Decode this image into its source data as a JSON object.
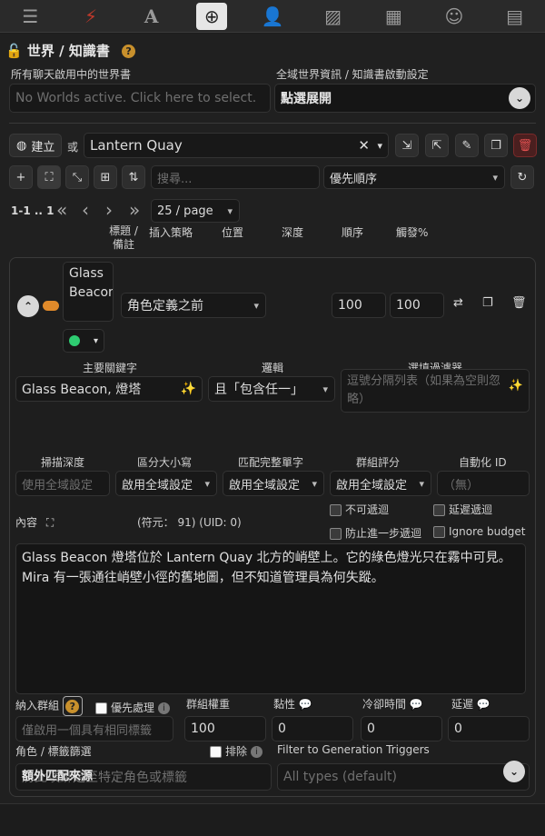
{
  "topbar": {
    "icons": [
      "sliders-icon",
      "plug-icon",
      "font-icon",
      "book-atlas-icon",
      "user-gear-icon",
      "image-icon",
      "cubes-icon",
      "smile-icon",
      "id-card-icon"
    ]
  },
  "header": {
    "title": "世界 / 知識書",
    "help": "?"
  },
  "worlds": {
    "label_active": "所有聊天啟用中的世界書",
    "placeholder": "No Worlds active. Click here to select.",
    "label_settings": "全域世界資訊 / 知識書啟動設定",
    "settings_value": "點選展開"
  },
  "book": {
    "create_label": "建立",
    "or_label": "或",
    "selected": "Lantern Quay"
  },
  "toolbar": {
    "search_placeholder": "搜尋...",
    "sort_value": "優先順序"
  },
  "pager": {
    "range": "1-1 .. 1",
    "per_page": "25 / page"
  },
  "columns": {
    "title": "標題 / 備註",
    "strategy": "插入策略",
    "position": "位置",
    "depth": "深度",
    "order": "順序",
    "trigger": "觸發%"
  },
  "entry": {
    "title": "Glass Beacon",
    "position": "角色定義之前",
    "order": "100",
    "trigger": "100",
    "primary_label": "主要關鍵字",
    "primary_keys": "Glass Beacon, 燈塔",
    "logic_label": "邏輯",
    "logic_value": "且「包含任一」",
    "filter_label": "選填過濾器",
    "filter_placeholder": "逗號分隔列表（如果為空則忽略）",
    "scan_label": "掃描深度",
    "scan_placeholder": "使用全域設定",
    "case_label": "區分大小寫",
    "case_value": "啟用全域設定",
    "whole_label": "匹配完整單字",
    "whole_value": "啟用全域設定",
    "group_score_label": "群組評分",
    "group_score_value": "啟用全域設定",
    "automation_label": "自動化 ID",
    "automation_placeholder": "（無）",
    "content_label": "內容",
    "token_info": "(符元： 91)  (UID: 0)",
    "cb_non_recursable": "不可遞迴",
    "cb_delay_recursion": "延遲遞迴",
    "cb_prevent_recursion": "防止進一步遞迴",
    "cb_ignore_budget": "Ignore budget",
    "content": "Glass Beacon 燈塔位於 Lantern Quay 北方的峭壁上。它的綠色燈光只在霧中可見。Mira 有一張通往峭壁小徑的舊地圖，但不知道管理員為何失蹤。",
    "inclusion_label": "納入群組",
    "prioritize_label": "優先處理",
    "group_weight_label": "群組權重",
    "sticky_label": "黏性",
    "cooldown_label": "冷卻時間",
    "delay_label": "延遲",
    "inclusion_placeholder": "僅啟用一個具有相同標籤",
    "group_weight": "100",
    "sticky": "0",
    "cooldown": "0",
    "delay": "0",
    "char_filter_label": "角色 / 標籤篩選",
    "exclude_label": "排除",
    "gen_triggers_label": "Filter to Generation Triggers",
    "char_filter_placeholder": "將此項綁定至特定角色或標籤",
    "gen_triggers_placeholder": "All types (default)",
    "extra_sources": "額外匹配來源"
  },
  "colors": {
    "accent_orange": "#e08a2a",
    "status_green": "#2ecc71",
    "danger_red": "#c0392b"
  }
}
